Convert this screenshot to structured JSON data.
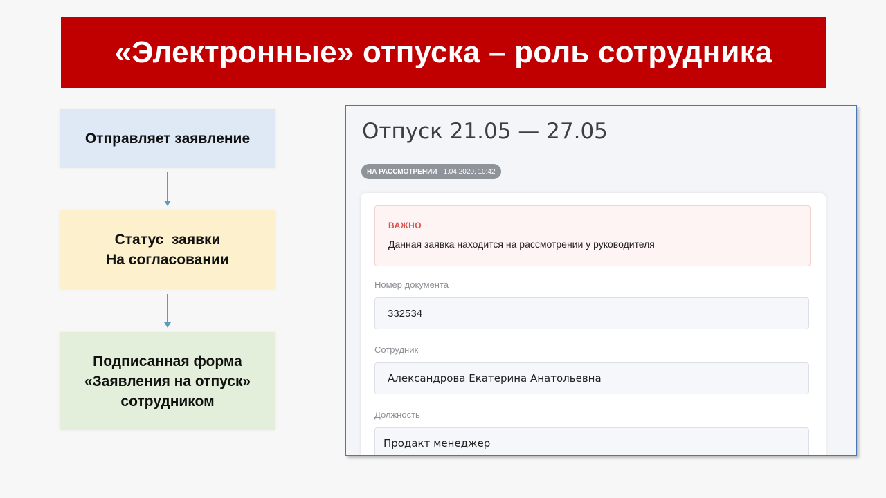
{
  "slide": {
    "title": "«Электронные» отпуска – роль сотрудника"
  },
  "flow": {
    "step1": "Отправляет заявление",
    "step2_line1": "Статус  заявки",
    "step2_line2": "На согласовании",
    "step3_line1": "Подписанная форма",
    "step3_line2": "«Заявления на отпуск»",
    "step3_line3": "сотрудником"
  },
  "app": {
    "page_title": "Отпуск 21.05 — 27.05",
    "status": {
      "label": "НА РАССМОТРЕНИИ",
      "datetime": "1.04.2020, 10:42",
      "color": "#8f939a"
    },
    "alert": {
      "title": "ВАЖНО",
      "text": "Данная заявка находится на рассмотрении у руководителя",
      "title_color": "#d9534f"
    },
    "fields": {
      "doc_number": {
        "label": "Номер документа",
        "value": "332534"
      },
      "employee": {
        "label": "Сотрудник",
        "value": "Александрова Екатерина Анатольевна"
      },
      "position": {
        "label": "Должность",
        "value": "Продакт менеджер"
      }
    }
  },
  "colors": {
    "title_bar": "#c00000",
    "step1_bg": "#dfe9f5",
    "step2_bg": "#fdf1cd",
    "step3_bg": "#e3efda",
    "arrow": "#5b9bbd"
  }
}
